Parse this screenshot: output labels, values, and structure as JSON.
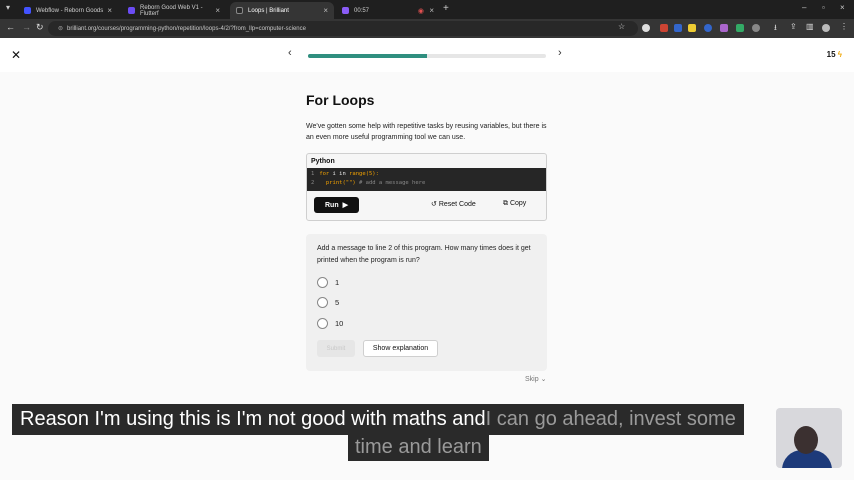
{
  "browser": {
    "tabs": [
      {
        "title": "Webflow - Reborn Goods",
        "color": "#4353ff",
        "active": false
      },
      {
        "title": "Reborn Good Web V1 - Flutterf",
        "color": "#6b4cf5",
        "active": false
      },
      {
        "title": "Loops | Brilliant",
        "color": "#2a2a2a",
        "active": true
      },
      {
        "title": "00:57",
        "color": "#8a5cf6",
        "active": false
      }
    ],
    "url": "brilliant.org/courses/programming-python/repetition/loops-4/2/?from_llp=computer-science"
  },
  "lesson": {
    "progress_fraction": 0.5,
    "streak": "15",
    "title": "For Loops",
    "intro": "We've gotten some help with repetitive tasks by reusing variables, but there is an even more useful programming tool we can use.",
    "code": {
      "language": "Python",
      "line1_num": "1",
      "line1_kw": "for",
      "line1_mid": " i in ",
      "line1_fn": "range",
      "line1_end": "(5):",
      "line2_num": "2",
      "line2_code": "  print(\"\")",
      "line2_comment": " # add a message here",
      "run_label": "Run",
      "reset_label": "Reset Code",
      "copy_label": "Copy"
    },
    "question": "Add a message to line 2 of this program. How many times does it get printed when the program is run?",
    "options": [
      "1",
      "5",
      "10"
    ],
    "submit_label": "Submit",
    "explain_label": "Show explanation",
    "skip_label": "Skip"
  },
  "captions": {
    "line1_bright": "Reason I'm using this is I'm not good with maths and",
    "line1_dim": " I can go ahead, invest some",
    "line2": "time and learn"
  }
}
